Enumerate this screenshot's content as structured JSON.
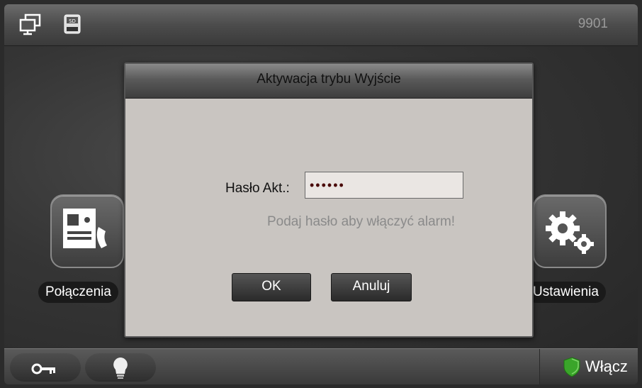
{
  "topbar": {
    "room_number": "9901"
  },
  "home_tiles": {
    "calls_label": "Połączenia",
    "settings_label": "Ustawienia"
  },
  "bottombar": {
    "arm_label": "Włącz"
  },
  "dialog": {
    "title": "Aktywacja trybu Wyjście",
    "password_label": "Hasło Akt.:",
    "password_value": "••••••",
    "hint": "Podaj hasło aby włączyć alarm!",
    "ok_label": "OK",
    "cancel_label": "Anuluj"
  },
  "icons": [
    "monitor-icon",
    "sd-card-icon",
    "intercom-call-icon",
    "gears-icon",
    "key-icon",
    "light-bulb-icon",
    "shield-icon"
  ],
  "colors": {
    "hint_text": "#8a8a8a",
    "shield_green": "#3aa52a"
  }
}
